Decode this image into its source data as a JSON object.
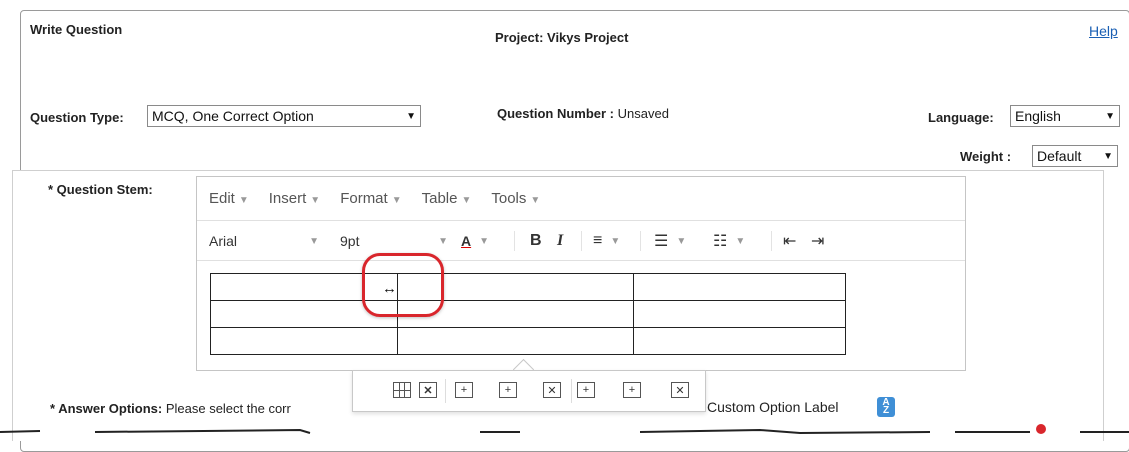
{
  "header": {
    "title": "Write Question",
    "project": "Project: Vikys Project",
    "help_label": "Help"
  },
  "question_type": {
    "label": "Question Type:",
    "value": "MCQ, One Correct Option"
  },
  "question_number": {
    "label": "Question Number :",
    "value": "Unsaved"
  },
  "language": {
    "label": "Language:",
    "value": "English"
  },
  "weight": {
    "label": "Weight :",
    "value": "Default"
  },
  "stem": {
    "label": "* Question Stem:"
  },
  "editor": {
    "menus": [
      "Edit",
      "Insert",
      "Format",
      "Table",
      "Tools"
    ],
    "font_family": "Arial",
    "font_size": "9pt",
    "table": {
      "rows": 3,
      "cols": 3
    }
  },
  "table_toolbar": {
    "icons": [
      "table-properties-icon",
      "delete-table-icon",
      "insert-row-before-icon",
      "insert-row-after-icon",
      "delete-row-icon",
      "insert-col-before-icon",
      "insert-col-after-icon",
      "delete-col-icon"
    ]
  },
  "answer_options": {
    "label": "* Answer Options:",
    "instruction_visible": "Please select the corr",
    "custom_label": "Custom Option Label"
  },
  "colors": {
    "highlight": "#d9262c",
    "link": "#1a5fb4",
    "sort_icon": "#3f8fd6"
  }
}
